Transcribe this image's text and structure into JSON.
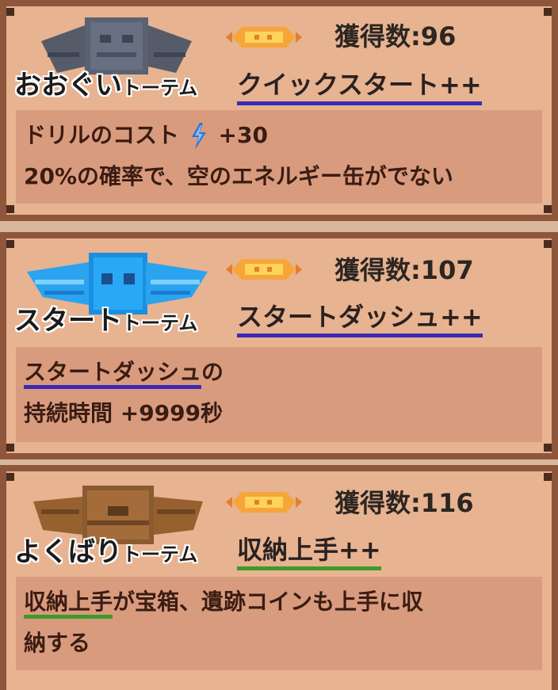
{
  "cards": [
    {
      "totem_name": "おおぐい",
      "totem_suffix": "トーテム",
      "count_label": "獲得数:96",
      "skill": "クイックスタート++",
      "desc_line1_a": "ドリルのコスト",
      "desc_line1_b": "+30",
      "desc_line2": "20%の確率で、空のエネルギー缶がでない",
      "totem_icon": "gray-winged-totem",
      "underline_color": "#3b2bb5"
    },
    {
      "totem_name": "スタート",
      "totem_suffix": "トーテム",
      "count_label": "獲得数:107",
      "skill": "スタートダッシュ++",
      "desc_line1_link": "スタートダッシュ",
      "desc_line1_rest": "の",
      "desc_line2": "持続時間 +9999秒",
      "totem_icon": "blue-winged-totem",
      "underline_color": "#3b2bb5"
    },
    {
      "totem_name": "よくばり",
      "totem_suffix": "トーテム",
      "count_label": "獲得数:116",
      "skill": "収納上手++",
      "desc_line1_link": "収納上手",
      "desc_line1_rest": "が宝箱、遺跡コインも上手に収",
      "desc_line2": "納する",
      "totem_icon": "treasure-chest-totem",
      "underline_color": "#3c9b2a"
    }
  ]
}
